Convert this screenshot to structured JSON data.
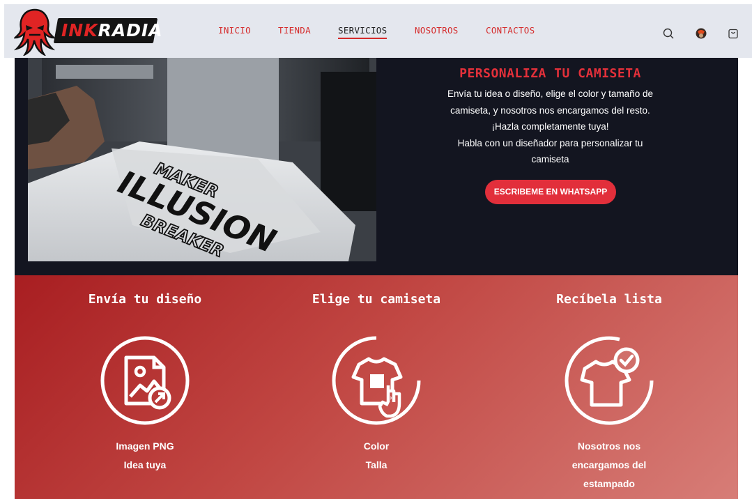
{
  "header": {
    "logo_text_a": "INK",
    "logo_text_b": "RADIA",
    "nav": [
      {
        "label": "INICIO",
        "active": false
      },
      {
        "label": "TIENDA",
        "active": false
      },
      {
        "label": "SERVICIOS",
        "active": true
      },
      {
        "label": "NOSOTROS",
        "active": false
      },
      {
        "label": "CONTACTOS",
        "active": false
      }
    ],
    "icons": [
      "search-icon",
      "user-avatar",
      "cart-icon"
    ]
  },
  "hero": {
    "photo_text": [
      "MAKER",
      "ILLUSION",
      "BREAKER"
    ],
    "title": "PERSONALIZA TU CAMISETA",
    "lines": [
      "Envía tu idea o diseño, elige el color y tamaño de",
      "camiseta, y nosotros nos encargamos del resto.",
      "¡Hazla completamente tuya!",
      "Habla con un diseñador para personalizar tu",
      "camiseta"
    ],
    "button_label": "ESCRIBEME EN WHATSAPP"
  },
  "steps": [
    {
      "title": "Envía tu diseño",
      "icon": "image-upload-icon",
      "lines": [
        "Imagen PNG",
        "Idea tuya"
      ]
    },
    {
      "title": "Elige tu camiseta",
      "icon": "tshirt-tap-icon",
      "lines": [
        "Color",
        "Talla"
      ]
    },
    {
      "title": "Recíbela lista",
      "icon": "tshirt-check-icon",
      "lines": [
        "Nosotros nos",
        "encargamos del",
        "estampado"
      ]
    }
  ],
  "colors": {
    "accent": "#e22f3b",
    "nav_red": "#d52b2b",
    "hero_bg": "#131520",
    "header_bg": "#e4e7ee"
  }
}
